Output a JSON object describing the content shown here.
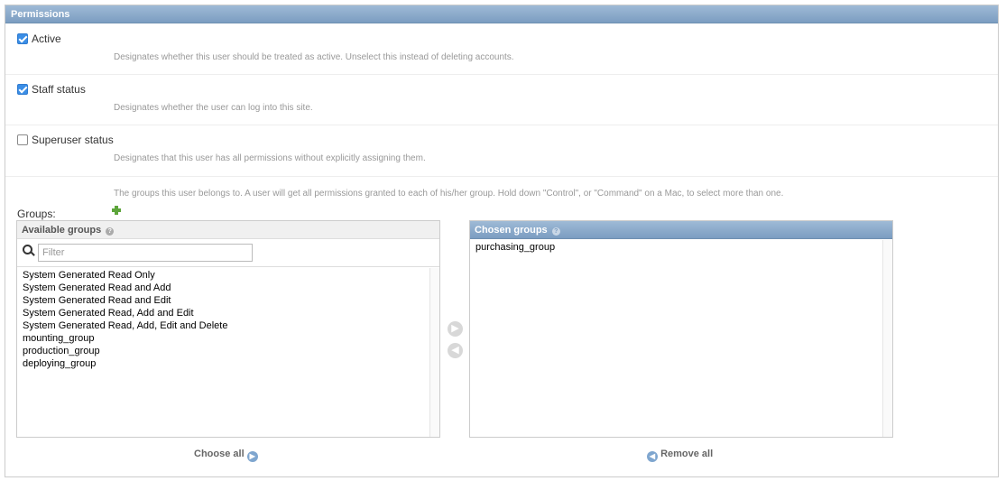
{
  "module": {
    "title": "Permissions"
  },
  "active": {
    "label": "Active",
    "checked": true,
    "help": "Designates whether this user should be treated as active. Unselect this instead of deleting accounts."
  },
  "staff": {
    "label": "Staff status",
    "checked": true,
    "help": "Designates whether the user can log into this site."
  },
  "superuser": {
    "label": "Superuser status",
    "checked": false,
    "help": "Designates that this user has all permissions without explicitly assigning them."
  },
  "groups": {
    "help": "The groups this user belongs to. A user will get all permissions granted to each of his/her group. Hold down \"Control\", or \"Command\" on a Mac, to select more than one.",
    "label": "Groups:",
    "available": {
      "title": "Available groups",
      "filter_placeholder": "Filter",
      "options": [
        "System Generated Read Only",
        "System Generated Read and Add",
        "System Generated Read and Edit",
        "System Generated Read, Add and Edit",
        "System Generated Read, Add, Edit and Delete",
        "mounting_group",
        "production_group",
        "deploying_group"
      ],
      "choose_all": "Choose all"
    },
    "chosen": {
      "title": "Chosen groups",
      "options": [
        "purchasing_group"
      ],
      "remove_all": "Remove all"
    }
  },
  "icons": {
    "help": "question-circle-icon",
    "add": "plus-icon",
    "search": "magnifier-icon",
    "move_right": "arrow-right-icon",
    "move_left": "arrow-left-icon"
  },
  "colors": {
    "header": "#7b9dc1",
    "checked": "#3b8ee6",
    "help_text": "#999999",
    "add_icon": "#5da53b"
  }
}
